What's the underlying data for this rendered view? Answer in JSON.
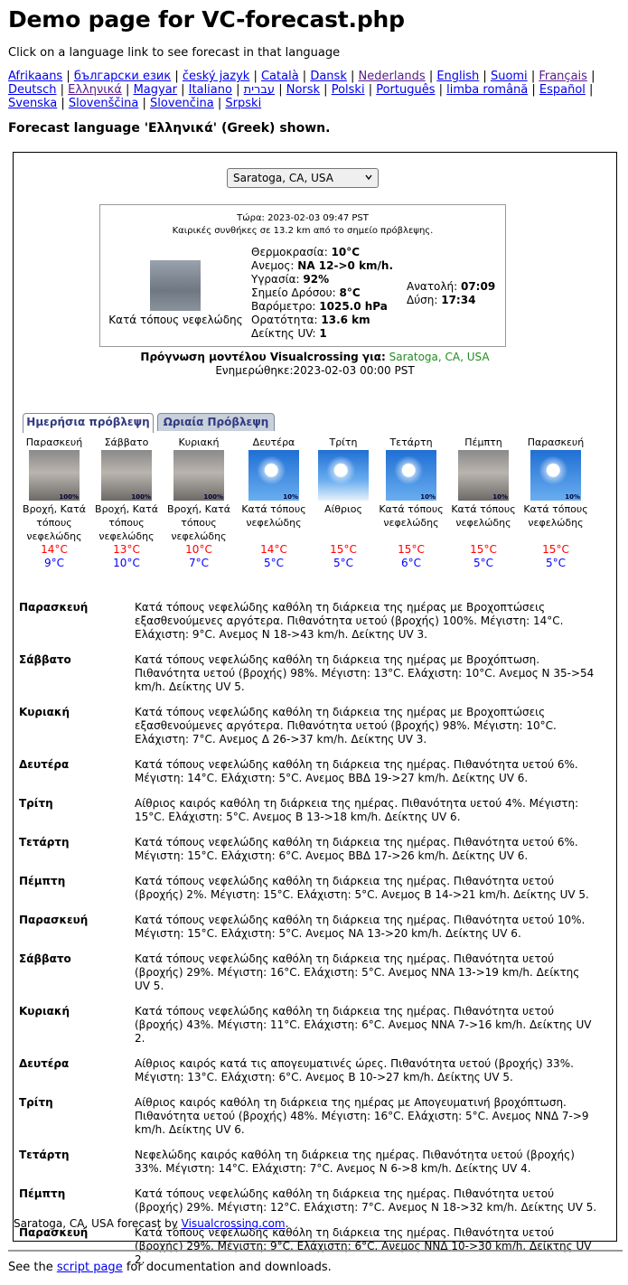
{
  "title": "Demo page for VC-forecast.php",
  "intro": "Click on a language link to see forecast in that language",
  "languages": [
    "Afrikaans",
    "български език",
    "český jazyk",
    "Català",
    "Dansk",
    "Nederlands",
    "English",
    "Suomi",
    "Français",
    "Deutsch",
    "Ελληνικά",
    "Magyar",
    "Italiano",
    "עברית",
    "Norsk",
    "Polski",
    "Português",
    "limba română",
    "Español",
    "Svenska",
    "Slovenščina",
    "Slovenčina",
    "Srpski"
  ],
  "forecast_lang": "Forecast language 'Ελληνικά' (Greek) shown.",
  "location_select": "Saratoga, CA, USA",
  "current": {
    "now": "Τώρα: 2023-02-03 09:47 PST",
    "conditions": "Καιρικές συνθήκες σε 13.2 km από το σημείο πρόβλεψης.",
    "image_caption": "Κατά τόπους νεφελώδης",
    "temp_label": "Θερμοκρασία:",
    "temp": "10°C",
    "wind_label": "Ανεμος:",
    "wind": "ΝΑ 12->0 km/h.",
    "hum_label": "Υγρασία:",
    "hum": "92%",
    "dew_label": "Σημείο Δρόσου:",
    "dew": "8°C",
    "baro_label": "Βαρόμετρο:",
    "baro": "1025.0 hPa",
    "vis_label": "Ορατότητα:",
    "vis": "13.6 km",
    "uv_label": "Δείκτης UV:",
    "uv": "1",
    "sunrise_label": "Ανατολή:",
    "sunrise": "07:09",
    "sunset_label": "Δύση:",
    "sunset": "17:34"
  },
  "model": {
    "label": "Πρόγνωση μοντέλου Visualcrossing για:",
    "location": "Saratoga, CA, USA",
    "updated": "Ενημερώθηκε:2023-02-03 00:00 PST"
  },
  "tabs": [
    "Ημερήσια πρόβλεψη",
    "Ωριαία Πρόβλεψη"
  ],
  "days": [
    {
      "name": "Παρασκευή",
      "icon": "rain",
      "pct": "100%",
      "text": "Βροχή, Κατά τόπους νεφελώδης",
      "hi": "14°C",
      "lo": "9°C"
    },
    {
      "name": "Σάββατο",
      "icon": "rain",
      "pct": "100%",
      "text": "Βροχή, Κατά τόπους νεφελώδης",
      "hi": "13°C",
      "lo": "10°C"
    },
    {
      "name": "Κυριακή",
      "icon": "rain",
      "pct": "100%",
      "text": "Βροχή, Κατά τόπους νεφελώδης",
      "hi": "10°C",
      "lo": "7°C"
    },
    {
      "name": "Δευτέρα",
      "icon": "sun",
      "pct": "10%",
      "text": "Κατά τόπους νεφελώδης",
      "hi": "14°C",
      "lo": "5°C"
    },
    {
      "name": "Τρίτη",
      "icon": "sun2",
      "pct": "",
      "text": "Αίθριος",
      "hi": "15°C",
      "lo": "5°C"
    },
    {
      "name": "Τετάρτη",
      "icon": "sun",
      "pct": "10%",
      "text": "Κατά τόπους νεφελώδης",
      "hi": "15°C",
      "lo": "6°C"
    },
    {
      "name": "Πέμπτη",
      "icon": "rain",
      "pct": "10%",
      "text": "Κατά τόπους νεφελώδης",
      "hi": "15°C",
      "lo": "5°C"
    },
    {
      "name": "Παρασκευή",
      "icon": "sun",
      "pct": "10%",
      "text": "Κατά τόπους νεφελώδης",
      "hi": "15°C",
      "lo": "5°C"
    }
  ],
  "details": [
    {
      "day": "Παρασκευή",
      "text": "Κατά τόπους νεφελώδης καθόλη τη διάρκεια της ημέρας με Βροχοπτώσεις εξασθενούμενες αργότερα. Πιθανότητα υετού (βροχής) 100%. Μέγιστη: 14°C. Ελάχιστη: 9°C. Ανεμος Ν 18->43 km/h. Δείκτης UV 3."
    },
    {
      "day": "Σάββατο",
      "text": "Κατά τόπους νεφελώδης καθόλη τη διάρκεια της ημέρας με Βροχόπτωση. Πιθανότητα υετού (βροχής) 98%. Μέγιστη: 13°C. Ελάχιστη: 10°C. Ανεμος Ν 35->54 km/h. Δείκτης UV 5."
    },
    {
      "day": "Κυριακή",
      "text": "Κατά τόπους νεφελώδης καθόλη τη διάρκεια της ημέρας με Βροχοπτώσεις εξασθενούμενες αργότερα. Πιθανότητα υετού (βροχής) 98%. Μέγιστη: 10°C. Ελάχιστη: 7°C. Ανεμος Δ 26->37 km/h. Δείκτης UV 3."
    },
    {
      "day": "Δευτέρα",
      "text": "Κατά τόπους νεφελώδης καθόλη τη διάρκεια της ημέρας. Πιθανότητα υετού 6%. Μέγιστη: 14°C. Ελάχιστη: 5°C. Ανεμος ΒΒΔ 19->27 km/h. Δείκτης UV 6."
    },
    {
      "day": "Τρίτη",
      "text": "Αίθριος καιρός καθόλη τη διάρκεια της ημέρας. Πιθανότητα υετού 4%. Μέγιστη: 15°C. Ελάχιστη: 5°C. Ανεμος Β 13->18 km/h. Δείκτης UV 6."
    },
    {
      "day": "Τετάρτη",
      "text": "Κατά τόπους νεφελώδης καθόλη τη διάρκεια της ημέρας. Πιθανότητα υετού 6%. Μέγιστη: 15°C. Ελάχιστη: 6°C. Ανεμος ΒΒΔ 17->26 km/h. Δείκτης UV 6."
    },
    {
      "day": "Πέμπτη",
      "text": "Κατά τόπους νεφελώδης καθόλη τη διάρκεια της ημέρας. Πιθανότητα υετού (βροχής) 2%. Μέγιστη: 15°C. Ελάχιστη: 5°C. Ανεμος Β 14->21 km/h. Δείκτης UV 5."
    },
    {
      "day": "Παρασκευή",
      "text": "Κατά τόπους νεφελώδης καθόλη τη διάρκεια της ημέρας. Πιθανότητα υετού 10%. Μέγιστη: 15°C. Ελάχιστη: 5°C. Ανεμος ΝΑ 13->20 km/h. Δείκτης UV 6."
    },
    {
      "day": "Σάββατο",
      "text": "Κατά τόπους νεφελώδης καθόλη τη διάρκεια της ημέρας. Πιθανότητα υετού (βροχής) 29%. Μέγιστη: 16°C. Ελάχιστη: 5°C. Ανεμος ΝΝΑ 13->19 km/h. Δείκτης UV 5."
    },
    {
      "day": "Κυριακή",
      "text": "Κατά τόπους νεφελώδης καθόλη τη διάρκεια της ημέρας. Πιθανότητα υετού (βροχής) 43%. Μέγιστη: 11°C. Ελάχιστη: 6°C. Ανεμος ΝΝΑ 7->16 km/h. Δείκτης UV 2."
    },
    {
      "day": "Δευτέρα",
      "text": "Αίθριος καιρός κατά τις απογευματινές ώρες. Πιθανότητα υετού (βροχής) 33%. Μέγιστη: 13°C. Ελάχιστη: 6°C. Ανεμος Β 10->27 km/h. Δείκτης UV 5."
    },
    {
      "day": "Τρίτη",
      "text": "Αίθριος καιρός καθόλη τη διάρκεια της ημέρας με Απογευματινή βροχόπτωση. Πιθανότητα υετού (βροχής) 48%. Μέγιστη: 16°C. Ελάχιστη: 5°C. Ανεμος ΝΝΔ 7->9 km/h. Δείκτης UV 6."
    },
    {
      "day": "Τετάρτη",
      "text": "Νεφελώδης καιρός καθόλη τη διάρκεια της ημέρας. Πιθανότητα υετού (βροχής) 33%. Μέγιστη: 14°C. Ελάχιστη: 7°C. Ανεμος Ν 6->8 km/h. Δείκτης UV 4."
    },
    {
      "day": "Πέμπτη",
      "text": "Κατά τόπους νεφελώδης καθόλη τη διάρκεια της ημέρας. Πιθανότητα υετού (βροχής) 29%. Μέγιστη: 12°C. Ελάχιστη: 7°C. Ανεμος Ν 18->32 km/h. Δείκτης UV 5."
    },
    {
      "day": "Παρασκευή",
      "text": "Κατά τόπους νεφελώδης καθόλη τη διάρκεια της ημέρας. Πιθανότητα υετού (βροχής) 29%. Μέγιστη: 9°C. Ελάχιστη: 6°C. Ανεμος ΝΝΔ 10->30 km/h. Δείκτης UV 2."
    }
  ],
  "credit": {
    "prefix": "Saratoga, CA, USA forecast by ",
    "link": "Visualcrossing.com",
    "suffix": "."
  },
  "footer": {
    "prefix": "See the ",
    "link": "script page",
    "suffix": " for documentation and downloads."
  }
}
